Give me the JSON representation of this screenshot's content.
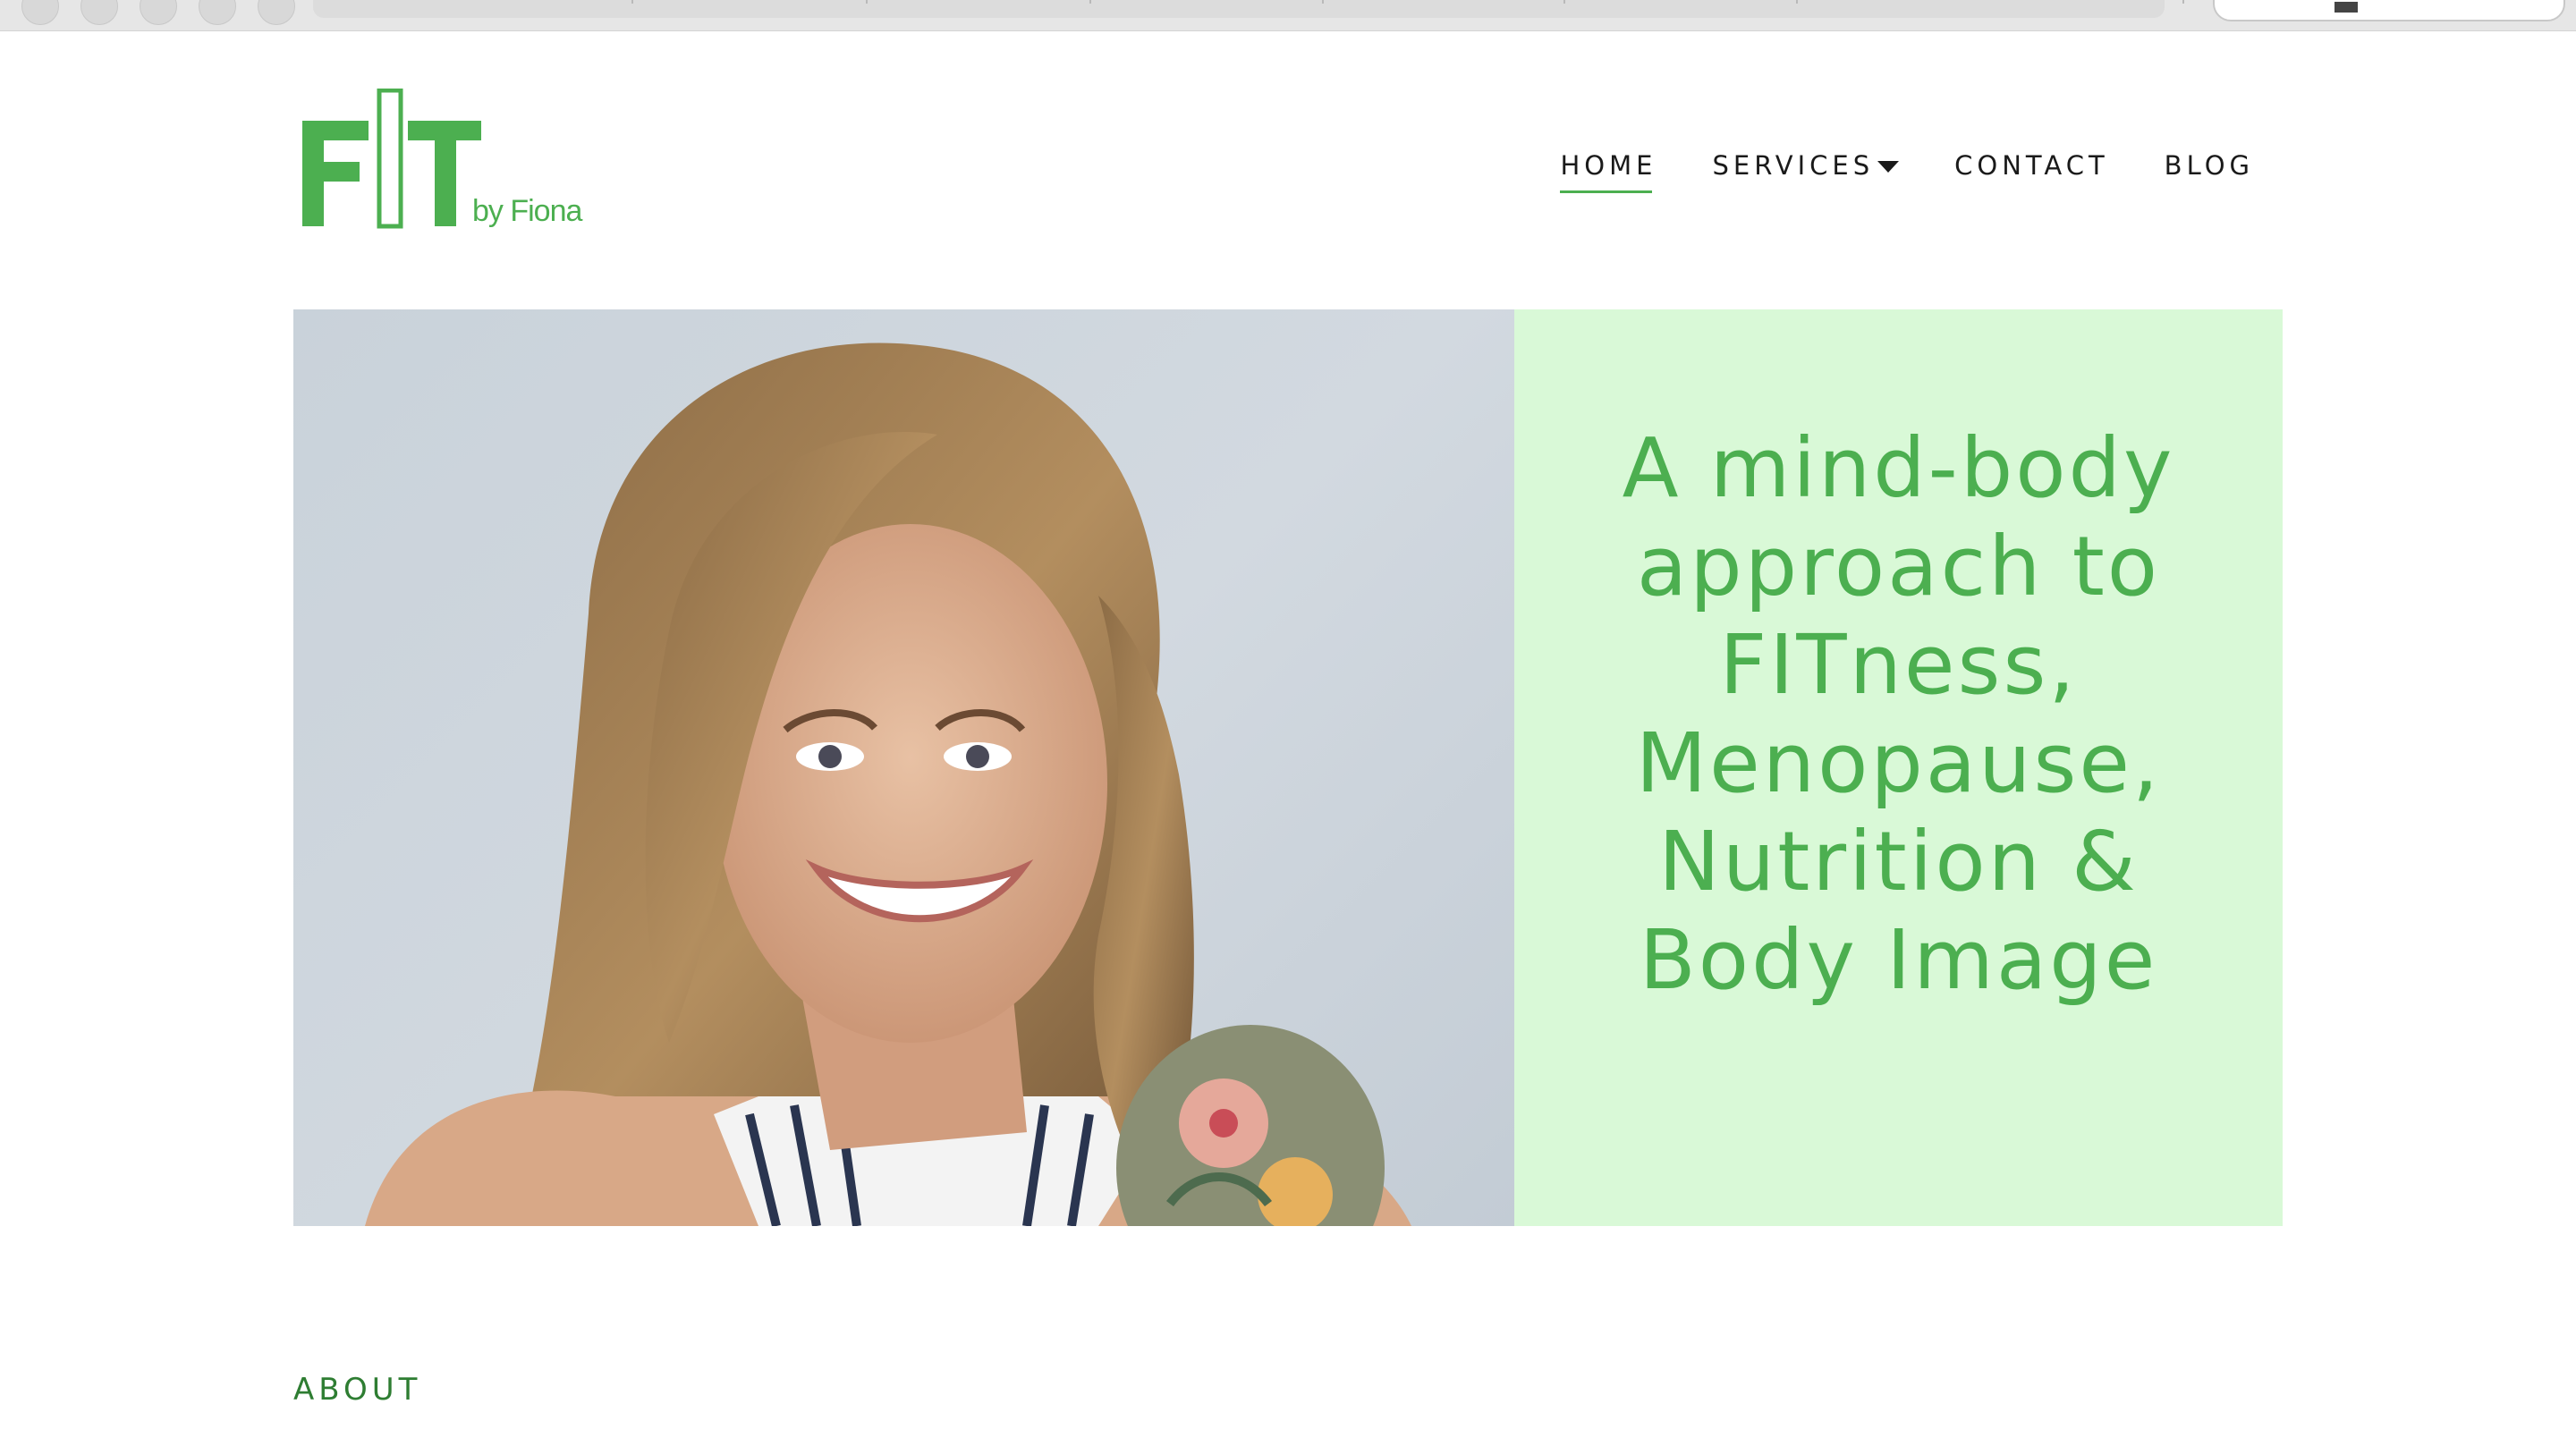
{
  "brand": {
    "logo_text": "FIT",
    "logo_sub": "by Fiona",
    "color": "#4caf50"
  },
  "nav": {
    "items": [
      {
        "label": "HOME",
        "active": true
      },
      {
        "label": "SERVICES",
        "has_dropdown": true
      },
      {
        "label": "CONTACT"
      },
      {
        "label": "BLOG"
      }
    ]
  },
  "hero": {
    "heading": "A mind-body approach to FITness, Menopause, Nutrition & Body Image",
    "panel_color": "#d9f9d7",
    "photo_icon": "portrait-photo"
  },
  "about": {
    "label": "ABOUT"
  }
}
